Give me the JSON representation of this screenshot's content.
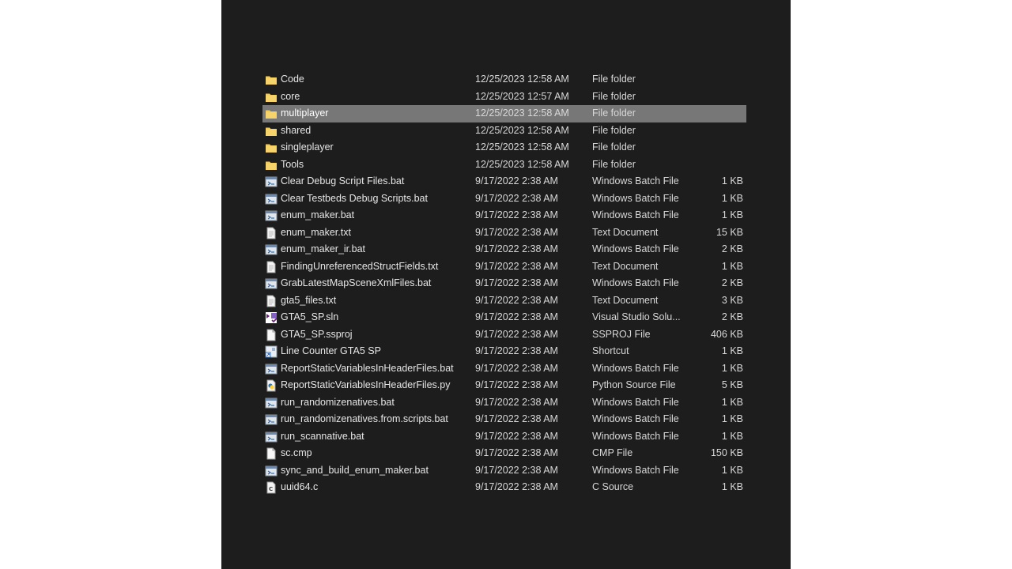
{
  "files": [
    {
      "name": "Code",
      "date": "12/25/2023 12:58 AM",
      "type": "File folder",
      "size": "",
      "icon": "folder-icon"
    },
    {
      "name": "core",
      "date": "12/25/2023 12:57 AM",
      "type": "File folder",
      "size": "",
      "icon": "folder-icon"
    },
    {
      "name": "multiplayer",
      "date": "12/25/2023 12:58 AM",
      "type": "File folder",
      "size": "",
      "icon": "folder-icon",
      "selected": true
    },
    {
      "name": "shared",
      "date": "12/25/2023 12:58 AM",
      "type": "File folder",
      "size": "",
      "icon": "folder-icon"
    },
    {
      "name": "singleplayer",
      "date": "12/25/2023 12:58 AM",
      "type": "File folder",
      "size": "",
      "icon": "folder-icon"
    },
    {
      "name": "Tools",
      "date": "12/25/2023 12:58 AM",
      "type": "File folder",
      "size": "",
      "icon": "folder-icon"
    },
    {
      "name": "Clear Debug Script Files.bat",
      "date": "9/17/2022 2:38 AM",
      "type": "Windows Batch File",
      "size": "1 KB",
      "icon": "batch-file-icon"
    },
    {
      "name": "Clear Testbeds Debug Scripts.bat",
      "date": "9/17/2022 2:38 AM",
      "type": "Windows Batch File",
      "size": "1 KB",
      "icon": "batch-file-icon"
    },
    {
      "name": "enum_maker.bat",
      "date": "9/17/2022 2:38 AM",
      "type": "Windows Batch File",
      "size": "1 KB",
      "icon": "batch-file-icon"
    },
    {
      "name": "enum_maker.txt",
      "date": "9/17/2022 2:38 AM",
      "type": "Text Document",
      "size": "15 KB",
      "icon": "text-file-icon"
    },
    {
      "name": "enum_maker_ir.bat",
      "date": "9/17/2022 2:38 AM",
      "type": "Windows Batch File",
      "size": "2 KB",
      "icon": "batch-file-icon"
    },
    {
      "name": "FindingUnreferencedStructFields.txt",
      "date": "9/17/2022 2:38 AM",
      "type": "Text Document",
      "size": "1 KB",
      "icon": "text-file-icon"
    },
    {
      "name": "GrabLatestMapSceneXmlFiles.bat",
      "date": "9/17/2022 2:38 AM",
      "type": "Windows Batch File",
      "size": "2 KB",
      "icon": "batch-file-icon"
    },
    {
      "name": "gta5_files.txt",
      "date": "9/17/2022 2:38 AM",
      "type": "Text Document",
      "size": "3 KB",
      "icon": "text-file-icon"
    },
    {
      "name": "GTA5_SP.sln",
      "date": "9/17/2022 2:38 AM",
      "type": "Visual Studio Solu...",
      "size": "2 KB",
      "icon": "visual-studio-solution-icon"
    },
    {
      "name": "GTA5_SP.ssproj",
      "date": "9/17/2022 2:38 AM",
      "type": "SSPROJ File",
      "size": "406 KB",
      "icon": "generic-file-icon"
    },
    {
      "name": "Line Counter GTA5 SP",
      "date": "9/17/2022 2:38 AM",
      "type": "Shortcut",
      "size": "1 KB",
      "icon": "shortcut-icon"
    },
    {
      "name": "ReportStaticVariablesInHeaderFiles.bat",
      "date": "9/17/2022 2:38 AM",
      "type": "Windows Batch File",
      "size": "1 KB",
      "icon": "batch-file-icon"
    },
    {
      "name": "ReportStaticVariablesInHeaderFiles.py",
      "date": "9/17/2022 2:38 AM",
      "type": "Python Source File",
      "size": "5 KB",
      "icon": "python-file-icon"
    },
    {
      "name": "run_randomizenatives.bat",
      "date": "9/17/2022 2:38 AM",
      "type": "Windows Batch File",
      "size": "1 KB",
      "icon": "batch-file-icon"
    },
    {
      "name": "run_randomizenatives.from.scripts.bat",
      "date": "9/17/2022 2:38 AM",
      "type": "Windows Batch File",
      "size": "1 KB",
      "icon": "batch-file-icon"
    },
    {
      "name": "run_scannative.bat",
      "date": "9/17/2022 2:38 AM",
      "type": "Windows Batch File",
      "size": "1 KB",
      "icon": "batch-file-icon"
    },
    {
      "name": "sc.cmp",
      "date": "9/17/2022 2:38 AM",
      "type": "CMP File",
      "size": "150 KB",
      "icon": "generic-file-icon"
    },
    {
      "name": "sync_and_build_enum_maker.bat",
      "date": "9/17/2022 2:38 AM",
      "type": "Windows Batch File",
      "size": "1 KB",
      "icon": "batch-file-icon"
    },
    {
      "name": "uuid64.c",
      "date": "9/17/2022 2:38 AM",
      "type": "C Source",
      "size": "1 KB",
      "icon": "c-source-file-icon"
    }
  ],
  "colors": {
    "panel_bg": "#1d1d1d",
    "selection_bg": "#777777",
    "text": "#e6e6e6",
    "folder": "#f2c94c"
  }
}
